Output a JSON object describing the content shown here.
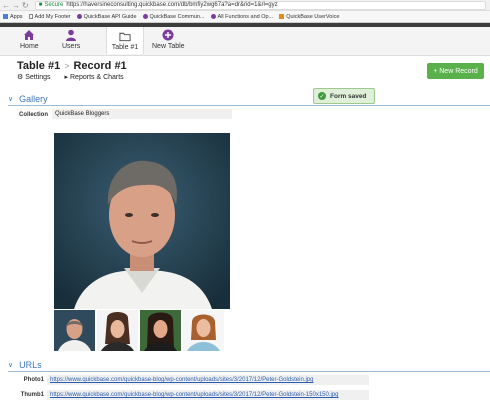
{
  "browser": {
    "secure_label": "Secure",
    "url": "https://haversineconsulting.quickbase.com/db/bmfiy2wg67a?a=dr&rid=1&rl=gyz"
  },
  "bookmarks": [
    {
      "label": "Apps",
      "icon": "apps-icon"
    },
    {
      "label": "Add My Footer",
      "icon": "page-icon"
    },
    {
      "label": "QuickBase API Guide",
      "icon": "quickbase-icon"
    },
    {
      "label": "QuickBase Commun...",
      "icon": "quickbase-icon"
    },
    {
      "label": "All Functions and Op...",
      "icon": "quickbase-icon"
    },
    {
      "label": "QuickBase UserVoice",
      "icon": "uservoice-icon"
    }
  ],
  "appnav": {
    "home_label": "Home",
    "users_label": "Users",
    "table_label": "Table #1",
    "new_table_label": "New Table"
  },
  "header": {
    "table_name": "Table #1",
    "separator": ">",
    "record_name": "Record #1",
    "settings_label": "Settings",
    "reports_label": "Reports & Charts",
    "new_record_label": "+ New Record"
  },
  "toast": {
    "message": "Form saved"
  },
  "gallery": {
    "section_title": "Gallery",
    "collection_label": "Collection",
    "collection_value": "QuickBase Bloggers"
  },
  "urls": {
    "section_title": "URLs",
    "photo1_label": "Photo1",
    "photo1_value": "https://www.quickbase.com/quickbase-blog/wp-content/uploads/sites/3/2017/12/Peter-Goldstein.jpg",
    "thumb1_label": "Thumb1",
    "thumb1_value": "https://www.quickbase.com/quickbase-blog/wp-content/uploads/sites/3/2017/12/Peter-Goldstein-150x150.jpg"
  },
  "colors": {
    "brand_purple": "#7c3c9c",
    "accent_blue": "#3a78b8",
    "new_record_green": "#5ab04a",
    "toast_green": "#dfefd9"
  }
}
